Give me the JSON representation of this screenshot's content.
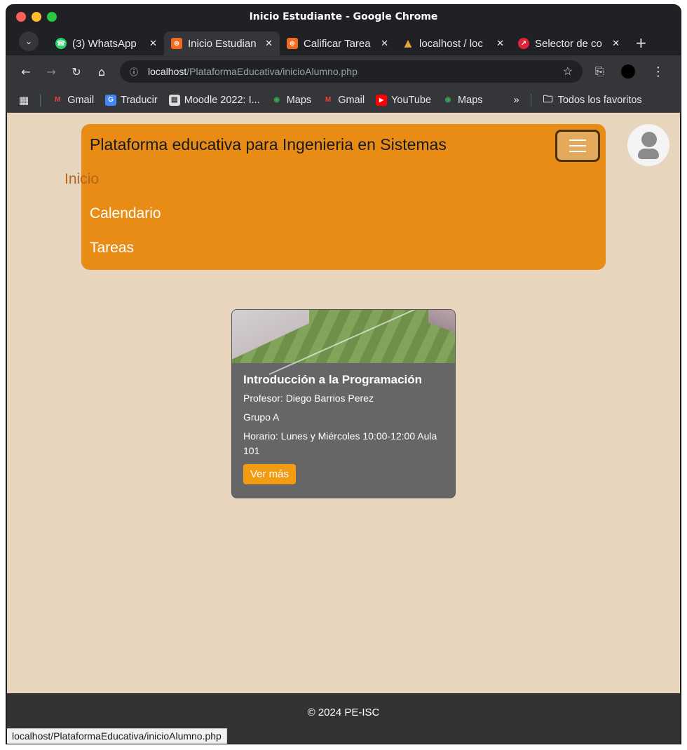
{
  "window": {
    "title": "Inicio Estudiante - Google Chrome"
  },
  "tabs": [
    {
      "label": "(3) WhatsApp",
      "icon": "whatsapp-icon",
      "color": "#25d366",
      "active": false
    },
    {
      "label": "Inicio Estudian",
      "icon": "xampp-icon",
      "color": "#f26b21",
      "active": true
    },
    {
      "label": "Calificar Tarea",
      "icon": "xampp-icon",
      "color": "#f26b21",
      "active": false
    },
    {
      "label": "localhost / loc",
      "icon": "phpmyadmin-icon",
      "color": "#e8a23b",
      "active": false
    },
    {
      "label": "Selector de co",
      "icon": "color-picker-icon",
      "color": "#e0243a",
      "active": false
    }
  ],
  "address": {
    "host": "localhost",
    "path": "/PlataformaEducativa/inicioAlumno.php"
  },
  "bookmarks": [
    {
      "label": "Gmail",
      "icon": "gmail-icon"
    },
    {
      "label": "Traducir",
      "icon": "translate-icon"
    },
    {
      "label": "Moodle 2022: I...",
      "icon": "moodle-icon"
    },
    {
      "label": "Maps",
      "icon": "maps-icon"
    },
    {
      "label": "Gmail",
      "icon": "gmail-icon"
    },
    {
      "label": "YouTube",
      "icon": "youtube-icon"
    },
    {
      "label": "Maps",
      "icon": "maps-icon"
    }
  ],
  "bookmarks_more": "»",
  "bookmarks_folder": "Todos los favoritos",
  "nav": {
    "brand": "Plataforma educativa para Ingenieria en Sistemas",
    "items": [
      "Inicio",
      "Calendario",
      "Tareas"
    ]
  },
  "course": {
    "title": "Introducción a la Programación",
    "professor": "Profesor: Diego Barrios Perez",
    "group": "Grupo A",
    "schedule": "Horario: Lunes y Miércoles 10:00-12:00 Aula 101",
    "button": "Ver más"
  },
  "footer": {
    "text": "© 2024 PE-ISC"
  },
  "status_url": "localhost/PlataformaEducativa/inicioAlumno.php",
  "colors": {
    "page_bg": "#e8d5bd",
    "nav_bg": "#e88c15",
    "inicio_color": "#b5651d",
    "card_bg": "#666666",
    "button_bg": "#f39c12",
    "footer_bg": "#333333"
  }
}
